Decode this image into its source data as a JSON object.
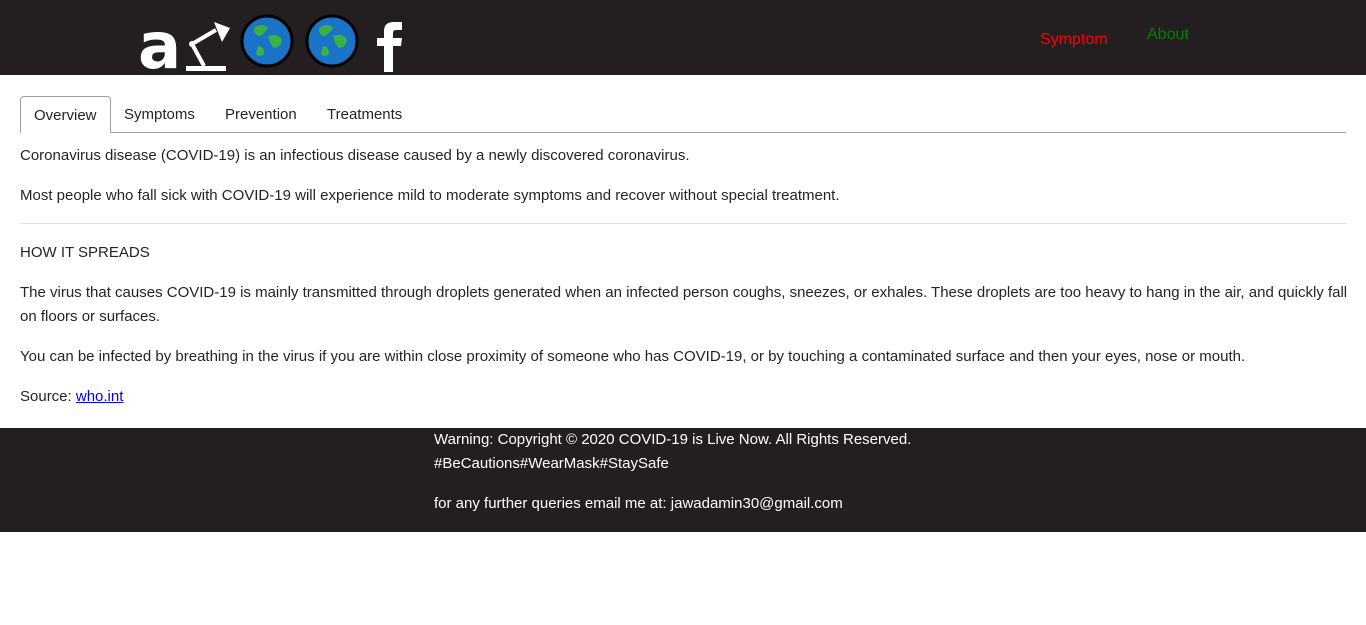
{
  "header": {
    "nav": {
      "symptom": "Symptom",
      "about": "About"
    },
    "colors": {
      "background": "#231f20",
      "symptom_link": "#ff0000",
      "about_link": "#008000"
    },
    "icons": [
      "a-logo",
      "lamp-icon",
      "globe-icon",
      "globe-icon",
      "facebook-icon"
    ]
  },
  "tabs": [
    {
      "label": "Overview",
      "active": true
    },
    {
      "label": "Symptoms",
      "active": false
    },
    {
      "label": "Prevention",
      "active": false
    },
    {
      "label": "Treatments",
      "active": false
    }
  ],
  "content": {
    "p1": "Coronavirus disease (COVID-19) is an infectious disease caused by a newly discovered coronavirus.",
    "p2": "Most people who fall sick with COVID-19 will experience mild to moderate symptoms and recover without special treatment.",
    "heading": "HOW IT SPREADS",
    "p3": "The virus that causes COVID-19 is mainly transmitted through droplets generated when an infected person coughs, sneezes, or exhales. These droplets are too heavy to hang in the air, and quickly fall on floors or surfaces.",
    "p4": "You can be infected by breathing in the virus if you are within close proximity of someone who has COVID-19, or by touching a contaminated surface and then your eyes, nose or mouth.",
    "source_label": "Source: ",
    "source_link": "who.int"
  },
  "footer": {
    "line1": "Warning: Copyright © 2020 COVID-19 is Live Now. All Rights Reserved.",
    "line2": "#BeCautions#WearMask#StaySafe",
    "line3": "for any further queries email me at: jawadamin30@gmail.com"
  }
}
